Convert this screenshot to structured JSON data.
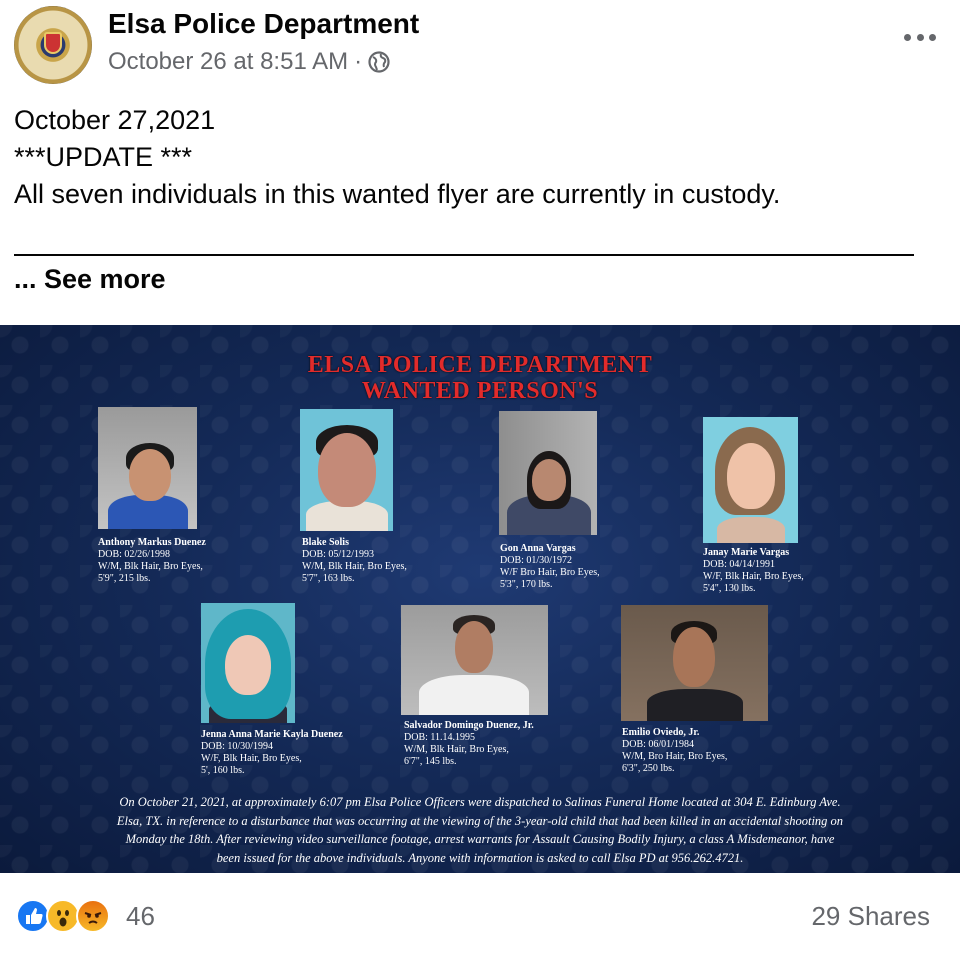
{
  "post": {
    "page_name": "Elsa Police Department",
    "timestamp": "October 26 at 8:51 AM",
    "meta_separator": "·",
    "privacy_icon": "globe-icon",
    "more_icon": "more-options-icon",
    "text_lines": [
      "October 27,2021",
      "***UPDATE ***",
      "All seven individuals in this wanted flyer are currently in custody."
    ],
    "see_more_label": "... See more"
  },
  "flyer": {
    "title_line1": "ELSA POLICE DEPARTMENT",
    "title_line2": "WANTED PERSON'S",
    "title_color": "#e22b2b",
    "persons": [
      {
        "name": "Anthony Markus Duenez",
        "dob": "DOB: 02/26/1998",
        "desc": "W/M, Blk Hair, Bro Eyes,",
        "size": "5'9\", 215 lbs."
      },
      {
        "name": "Blake Solis",
        "dob": "DOB: 05/12/1993",
        "desc": "W/M, Blk Hair, Bro Eyes,",
        "size": "5'7\", 163 lbs."
      },
      {
        "name": "Gon Anna Vargas",
        "dob": "DOB: 01/30/1972",
        "desc": "W/F Bro Hair, Bro Eyes,",
        "size": "5'3\", 170 lbs."
      },
      {
        "name": "Janay Marie Vargas",
        "dob": "DOB: 04/14/1991",
        "desc": "W/F, Blk Hair, Bro Eyes,",
        "size": "5'4\", 130 lbs."
      },
      {
        "name": "Jenna Anna Marie Kayla Duenez",
        "dob": "DOB: 10/30/1994",
        "desc": "W/F, Blk Hair, Bro Eyes,",
        "size": "5', 160 lbs."
      },
      {
        "name": "Salvador Domingo Duenez, Jr.",
        "dob": "DOB: 11.14.1995",
        "desc": "W/M, Blk Hair, Bro Eyes,",
        "size": "6'7\", 145 lbs."
      },
      {
        "name": "Emilio Oviedo, Jr.",
        "dob": "DOB: 06/01/1984",
        "desc": "W/M, Bro Hair, Bro Eyes,",
        "size": "6'3\", 250 lbs."
      }
    ],
    "description_lines": [
      "On October 21, 2021, at approximately 6:07 pm Elsa Police Officers were dispatched to Salinas Funeral Home located at 304 E. Edinburg Ave.",
      "Elsa, TX. in reference to a disturbance that was occurring at the viewing of the 3-year-old child that had been killed in an accidental shooting on",
      "Monday the 18th. After reviewing video surveillance footage, arrest warrants for Assault Causing Bodily Injury, a class A Misdemeanor, have",
      "been issued for the above individuals. Anyone with information is asked to call Elsa PD at 956.262.4721."
    ]
  },
  "footer": {
    "reaction_icons": [
      "like-icon",
      "wow-icon",
      "angry-icon"
    ],
    "reaction_count": "46",
    "shares_label": "29 Shares"
  },
  "colors": {
    "facebook_blue": "#1877f2",
    "secondary_text": "#65676b",
    "flyer_background": "#142a58"
  }
}
